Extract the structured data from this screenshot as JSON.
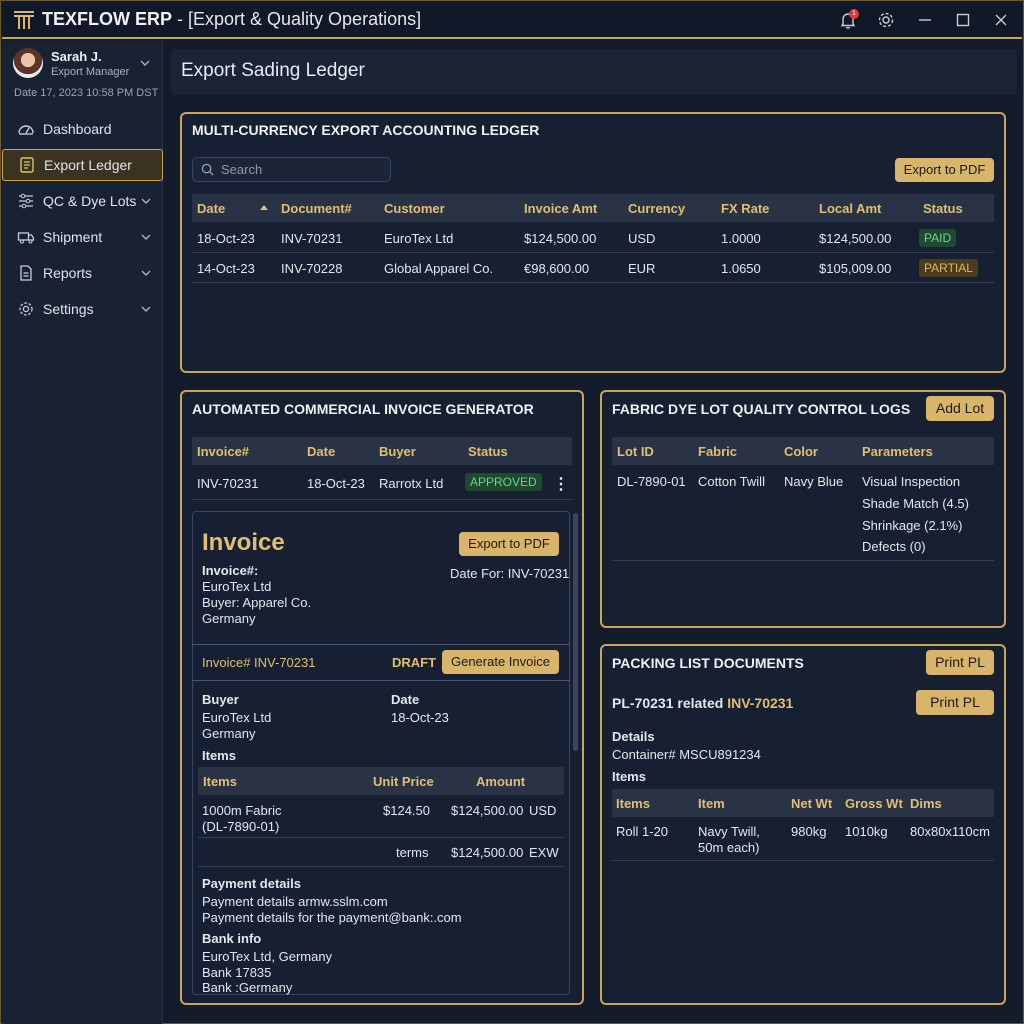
{
  "app": {
    "brand": "TEXFLOW ERP",
    "subtitle": " - [Export & Quality Operations]",
    "notification_count": "1"
  },
  "user": {
    "name": "Sarah J.",
    "role": "Export Manager",
    "date": "Date 17, 2023 10:58 PM DST"
  },
  "nav": [
    {
      "label": "Dashboard",
      "icon": "dashboard-icon"
    },
    {
      "label": "Export Ledger",
      "icon": "ledger-icon"
    },
    {
      "label": "QC & Dye Lots",
      "icon": "sliders-icon"
    },
    {
      "label": "Shipment",
      "icon": "truck-icon"
    },
    {
      "label": "Reports",
      "icon": "report-icon"
    },
    {
      "label": "Settings",
      "icon": "gear-icon"
    }
  ],
  "page_title": "Export Sading Ledger",
  "ledger": {
    "title": "MULTI-CURRENCY EXPORT ACCOUNTING LEDGER",
    "search_placeholder": "Search",
    "export_label": "Export to PDF",
    "columns": [
      "Date",
      "Document#",
      "Customer",
      "Invoice Amt",
      "Currency",
      "FX Rate",
      "Local Amt",
      "Status"
    ],
    "rows": [
      [
        "18-Oct-23",
        "INV-70231",
        "EuroTex Ltd",
        "$124,500.00",
        "USD",
        "1.0000",
        "$124,500.00",
        "PAID"
      ],
      [
        "14-Oct-23",
        "INV-70228",
        "Global Apparel Co.",
        "€98,600.00",
        "EUR",
        "1.0650",
        "$105,009.00",
        "PARTIAL"
      ]
    ]
  },
  "invoice_gen": {
    "title": "AUTOMATED COMMERCIAL INVOICE GENERATOR",
    "columns": [
      "Invoice#",
      "Date",
      "Buyer",
      "Status"
    ],
    "row": [
      "INV-70231",
      "18-Oct-23",
      "Rarrotx Ltd",
      "APPROVED"
    ],
    "preview": {
      "heading": "Invoice",
      "export_label": "Export to PDF",
      "invoice_label": "Invoice#:",
      "company": "EuroTex Ltd",
      "buyer_line": "Buyer: Apparel Co.",
      "country": "Germany",
      "date_for": "Date For: INV-70231",
      "sub_invoice": "Invoice# INV-70231",
      "draft": "DRAFT",
      "generate_label": "Generate Invoice",
      "buyer_label": "Buyer",
      "buyer_name": "EuroTex Ltd",
      "buyer_country": "Germany",
      "date_label": "Date",
      "date_value": "18-Oct-23",
      "items_label": "Items",
      "item_columns": [
        "Items",
        "Unit Price",
        "Amount"
      ],
      "item_desc_1": "1000m Fabric",
      "item_desc_2": "(DL-7890-01)",
      "item_price": "$124.50",
      "item_amount": "$124,500.00",
      "item_currency": "USD",
      "terms_label": "terms",
      "terms_amount": "$124,500.00",
      "terms_code": "EXW",
      "payment_label": "Payment details",
      "payment_1": "Payment details armw.sslm.com",
      "payment_2": "Payment details for the payment@bank:.com",
      "bank_label": "Bank info",
      "bank_1": "EuroTex Ltd, Germany",
      "bank_2": "Bank 17835",
      "bank_3": "Bank :Germany"
    }
  },
  "dyelot": {
    "title": "FABRIC DYE LOT QUALITY CONTROL LOGS",
    "add_label": "Add Lot",
    "columns": [
      "Lot ID",
      "Fabric",
      "Color",
      "Parameters"
    ],
    "row": {
      "lot": "DL-7890-01",
      "fabric": "Cotton Twill",
      "color": "Navy Blue",
      "params": [
        "Visual Inspection",
        "Shade Match (4.5)",
        "Shrinkage (2.1%)",
        "Defects (0)"
      ]
    }
  },
  "packing": {
    "title": "PACKING LIST DOCUMENTS",
    "print_label": "Print PL",
    "pl_prefix": "PL-70231 related",
    "pl_invoice": "INV-70231",
    "print_label_2": "Print PL",
    "details_label": "Details",
    "container": "Container# MSCU891234",
    "items_label": "Items",
    "columns": [
      "Items",
      "Item",
      "Net Wt",
      "Gross Wt",
      "Dims"
    ],
    "row": {
      "items": "Roll 1-20",
      "item_1": "Navy Twill,",
      "item_2": "50m each)",
      "net": "980kg",
      "gross": "1010kg",
      "dims": "80x80x110cm"
    }
  },
  "colors": {
    "accent": "#c9a55a",
    "button": "#d8b56a",
    "paid": "#6fd08a",
    "partial": "#e0b567",
    "background": "#141c2b"
  }
}
